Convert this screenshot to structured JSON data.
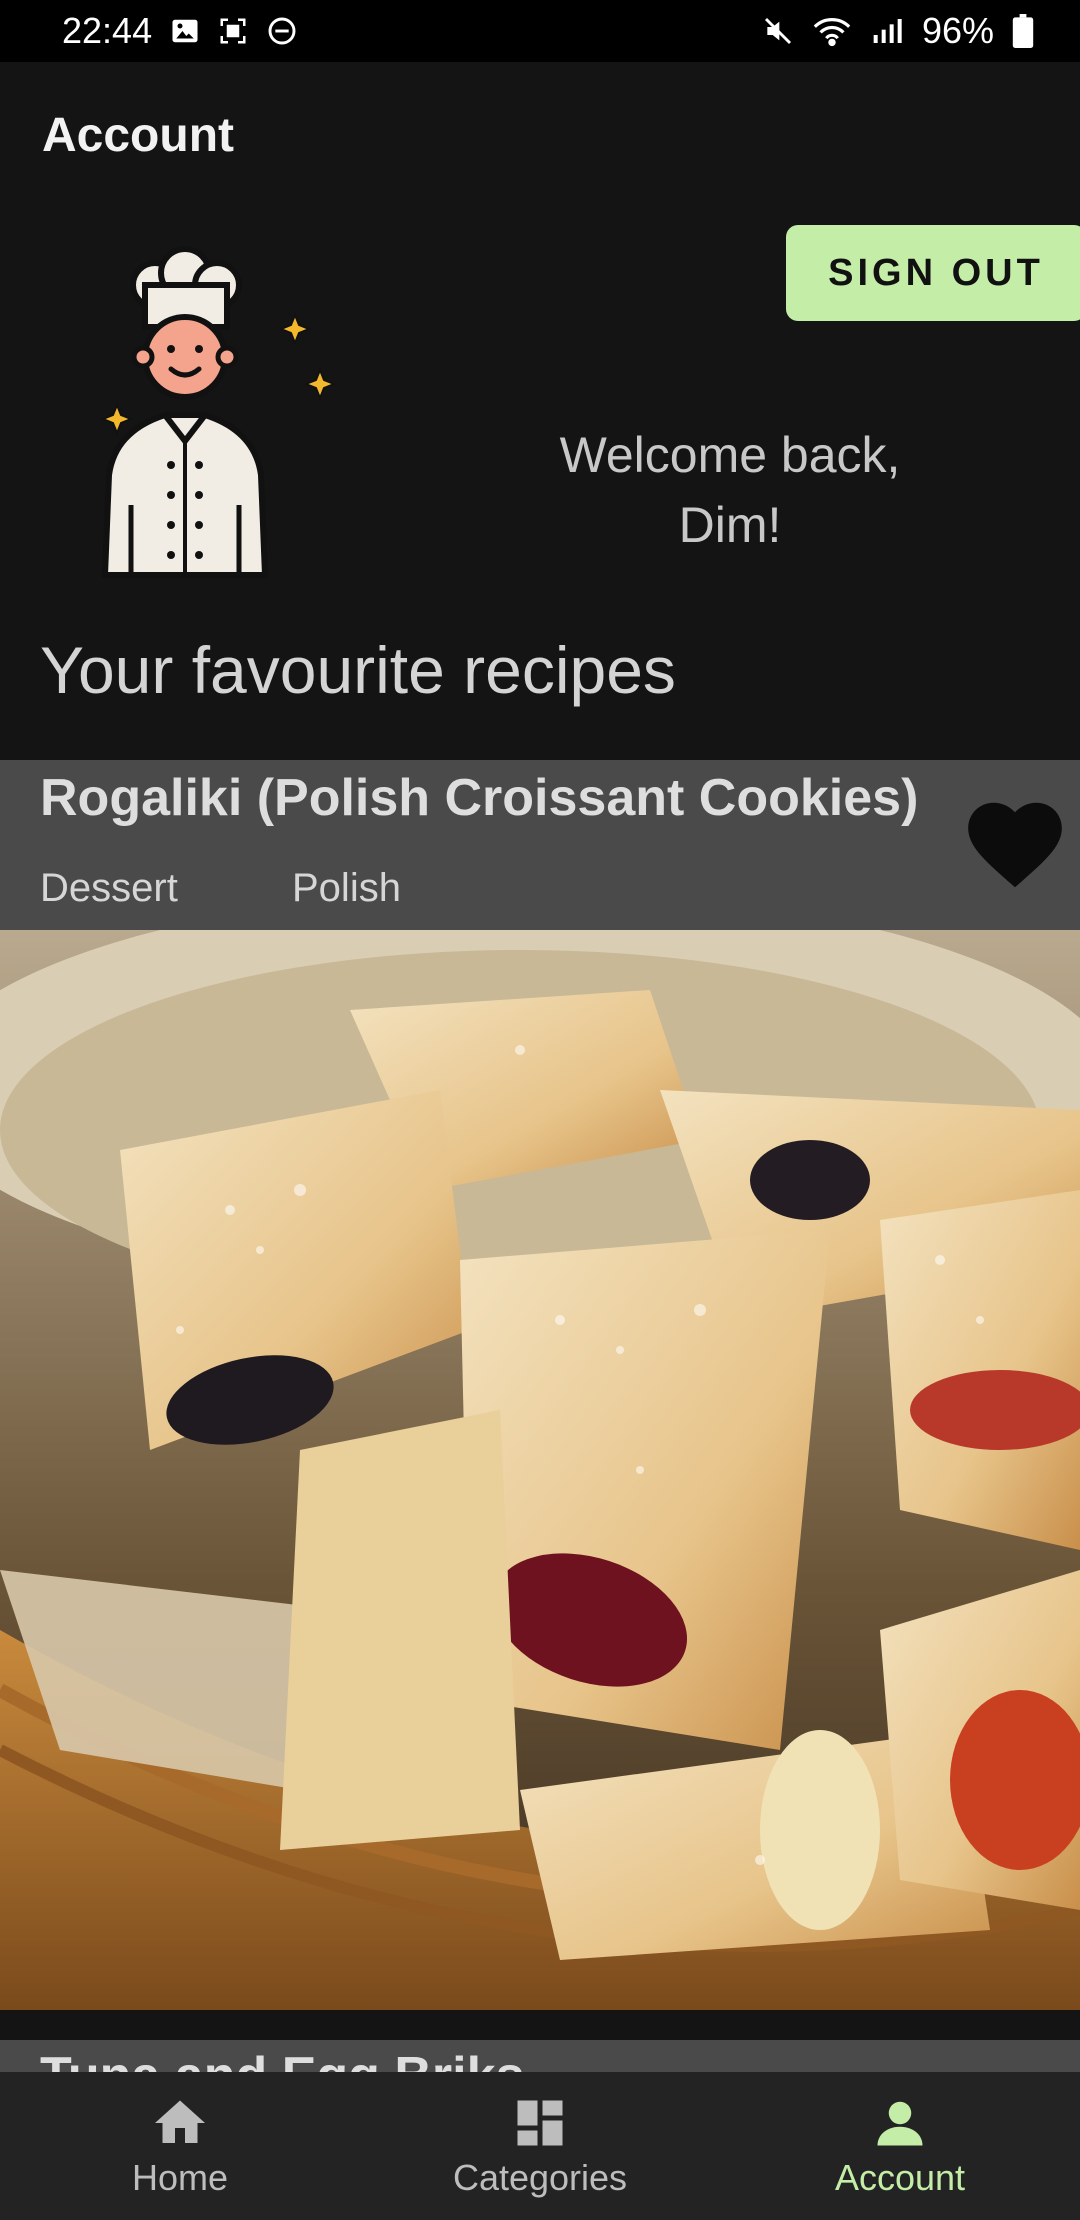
{
  "status_bar": {
    "time": "22:44",
    "battery": "96%",
    "icons": [
      "gallery-icon",
      "screenshot-icon",
      "dnd-icon",
      "mute-icon",
      "wifi-icon",
      "signal-icon",
      "battery-icon"
    ]
  },
  "header": {
    "title": "Account",
    "sign_out_label": "SIGN OUT",
    "welcome_line1": "Welcome back,",
    "welcome_line2": "Dim!"
  },
  "favourites": {
    "section_title": "Your favourite recipes",
    "recipes": [
      {
        "title": "Rogaliki (Polish Croissant Cookies)",
        "category": "Dessert",
        "area": "Polish",
        "favourited": true
      },
      {
        "title": "Tuna and Egg Briks"
      }
    ]
  },
  "bottom_nav": {
    "items": [
      {
        "label": "Home",
        "icon": "home-icon",
        "active": false
      },
      {
        "label": "Categories",
        "icon": "dashboard-icon",
        "active": false
      },
      {
        "label": "Account",
        "icon": "person-icon",
        "active": true
      }
    ]
  },
  "colors": {
    "background": "#141414",
    "accent": "#c4eda8",
    "card": "#4a4a4a",
    "nav": "#232323"
  }
}
